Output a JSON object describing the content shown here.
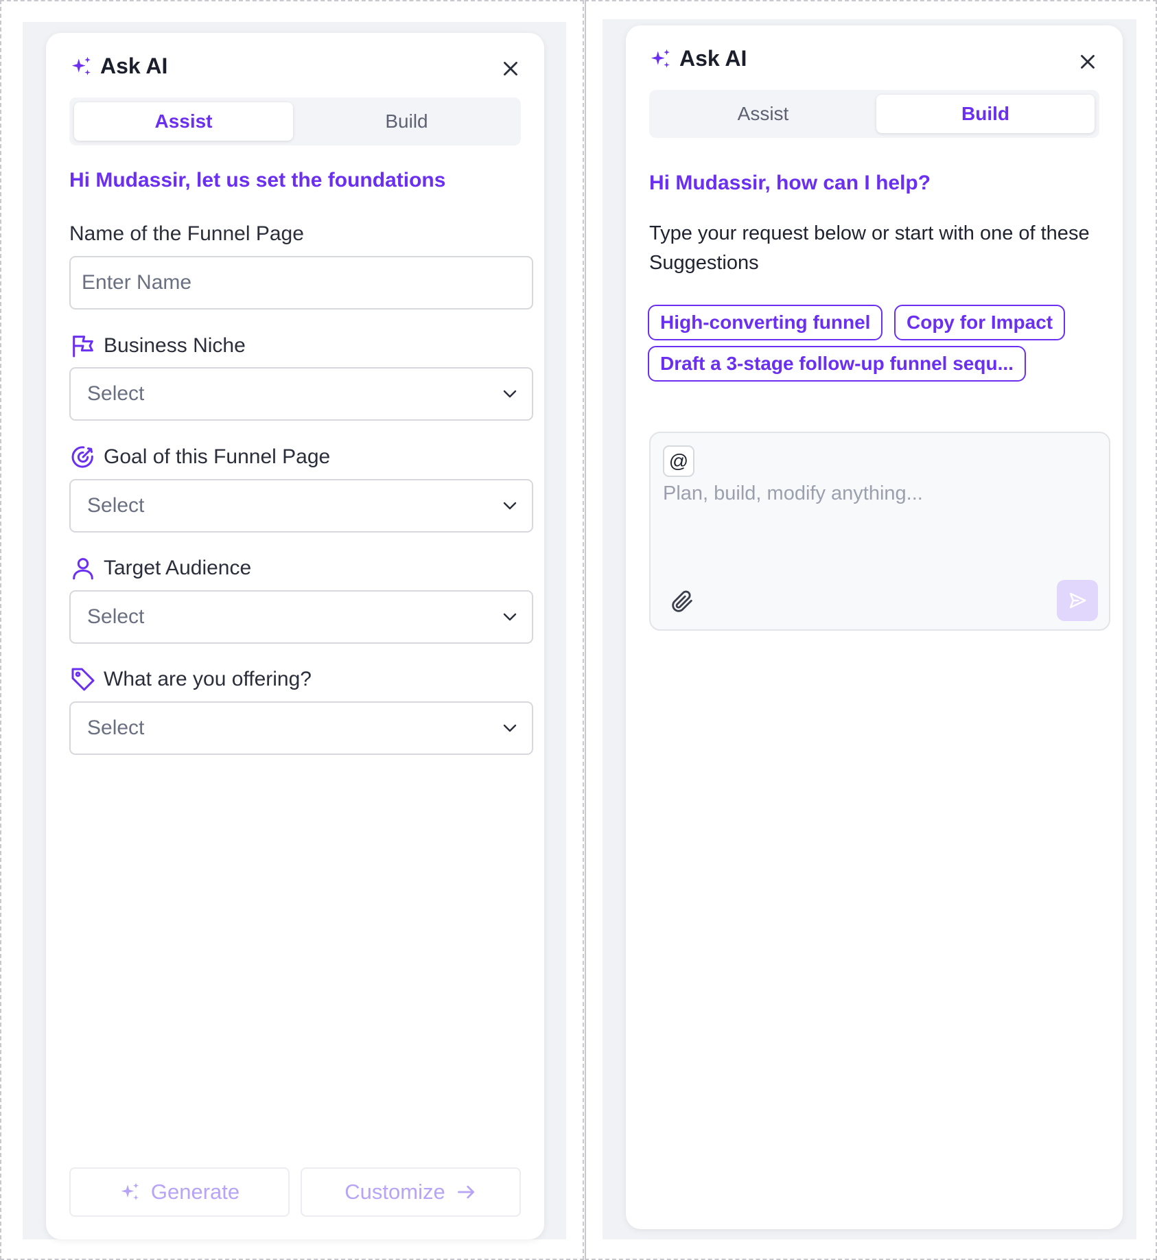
{
  "colors": {
    "accent": "#6a2ff0",
    "accent_disabled": "#b7a4f6",
    "panel_bg": "#ffffff",
    "page_bg": "#f1f2f5"
  },
  "assist_panel": {
    "title": "Ask AI",
    "tabs": [
      {
        "label": "Assist",
        "active": true
      },
      {
        "label": "Build",
        "active": false
      }
    ],
    "greeting": "Hi Mudassir, let us set the foundations",
    "fields": {
      "name": {
        "label": "Name of the Funnel Page",
        "placeholder": "Enter Name",
        "value": ""
      },
      "niche": {
        "label": "Business Niche",
        "icon": "flag-icon",
        "value": "Select"
      },
      "goal": {
        "label": "Goal of this Funnel Page",
        "icon": "target-icon",
        "value": "Select"
      },
      "audience": {
        "label": "Target Audience",
        "icon": "user-icon",
        "value": "Select"
      },
      "offering": {
        "label": "What are you offering?",
        "icon": "tag-icon",
        "value": "Select"
      }
    },
    "generate_label": "Generate",
    "customize_label": "Customize"
  },
  "build_panel": {
    "title": "Ask AI",
    "tabs": [
      {
        "label": "Assist",
        "active": false
      },
      {
        "label": "Build",
        "active": true
      }
    ],
    "greeting": "Hi Mudassir, how can I help?",
    "description": "Type your request below or start with one of these Suggestions",
    "suggestions": [
      "High-converting funnel",
      "Copy for Impact",
      "Draft a 3-stage follow-up funnel sequ..."
    ],
    "composer": {
      "mention_symbol": "@",
      "placeholder": "Plan, build, modify anything...",
      "value": ""
    }
  }
}
